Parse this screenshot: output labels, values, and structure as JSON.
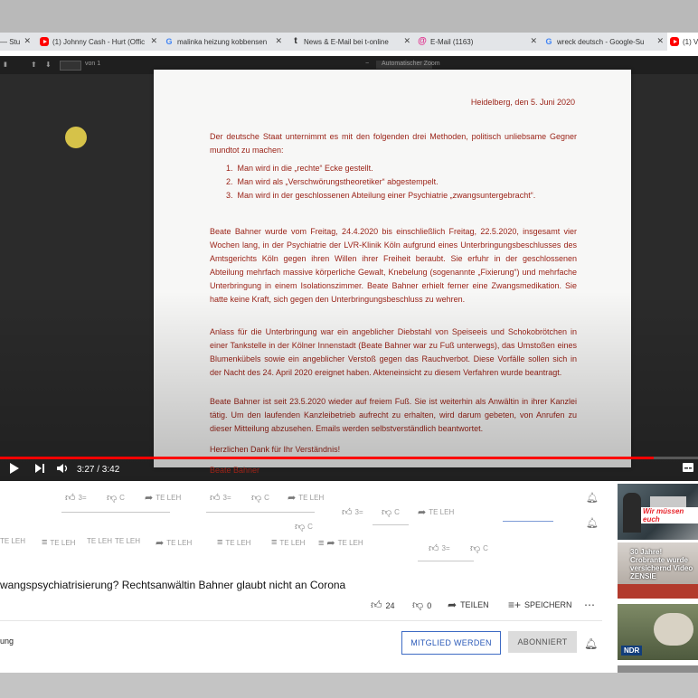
{
  "browser": {
    "tabs": [
      {
        "label": "— Stu",
        "icon": "",
        "active": false
      },
      {
        "label": "(1) Johnny Cash - Hurt (Offic",
        "icon": "youtube-favicon",
        "active": false
      },
      {
        "label": "malinka heizung kobbensen",
        "icon": "google-favicon",
        "active": false
      },
      {
        "label": "News & E-Mail bei t-online",
        "icon": "t-online-favicon",
        "active": false
      },
      {
        "label": "E-Mail (1163)",
        "icon": "email-favicon",
        "active": false
      },
      {
        "label": "wreck deutsch - Google-Su",
        "icon": "google-favicon",
        "active": false
      },
      {
        "label": "(1) V",
        "icon": "youtube-favicon",
        "active": true
      }
    ]
  },
  "pdf_viewer": {
    "page_label": "von 1",
    "zoom_label": "Automatischer Zoom"
  },
  "letter": {
    "place_date": "Heidelberg, den 5. Juni 2020",
    "intro": "Der deutsche Staat unternimmt es mit den folgenden drei Methoden, politisch unliebsame Gegner mundtot zu machen:",
    "list": [
      "Man wird in die „rechte“ Ecke gestellt.",
      "Man wird als „Verschwörungstheoretiker“ abgestempelt.",
      "Man wird in der geschlossenen Abteilung einer Psychiatrie „zwangsuntergebracht“."
    ],
    "para1": "Beate Bahner wurde vom Freitag, 24.4.2020 bis einschließlich Freitag, 22.5.2020, insgesamt vier Wochen lang, in der Psychiatrie der LVR-Klinik Köln aufgrund eines Unterbringungsbeschlusses des Amtsgerichts Köln gegen ihren Willen ihrer Freiheit beraubt. Sie erfuhr in der geschlossenen Abteilung mehrfach massive körperliche Gewalt, Knebelung (sogenannte „Fixierung“) und mehrfache Unterbringung in einem Isolationszimmer. Beate Bahner erhielt ferner eine Zwangsmedikation. Sie hatte keine Kraft, sich gegen den Unterbringungsbeschluss zu wehren.",
    "para2": "Anlass für die Unterbringung war ein angeblicher Diebstahl von Speiseeis und Schokobrötchen in einer Tankstelle in der Kölner Innenstadt (Beate Bahner war zu Fuß unterwegs), das Umstoßen eines Blumenkübels sowie ein angeblicher Verstoß gegen das Rauchverbot. Diese Vorfälle sollen sich in der Nacht des 24. April 2020 ereignet haben. Akteneinsicht zu diesem Verfahren wurde beantragt.",
    "para3": "Beate Bahner ist seit 23.5.2020 wieder auf freiem Fuß. Sie ist weiterhin als Anwältin in ihrer Kanzlei tätig. Um den laufenden Kanzleibetrieb aufrecht zu erhalten, wird darum gebeten, von Anrufen zu dieser Mitteilung abzusehen. Emails werden selbstverständlich beantwortet.",
    "closing": "Herzlichen Dank für Ihr Verständnis!",
    "signature": "Beate Bahner"
  },
  "player": {
    "time": "3:27 / 3:42",
    "progress": 0.936
  },
  "ghost": {
    "likes": "3=",
    "dislikes": "C",
    "share": "TE LEH",
    "save": "TE LEH"
  },
  "video": {
    "title": "wangspsychiatrisierung? Rechtsanwältin Bahner glaubt nicht an Corona",
    "likes": "24",
    "dislikes": "0",
    "share_label": "TEILEN",
    "save_label": "SPEICHERN",
    "channel_fragment": "ung",
    "member_button": "MITGLIED WERDEN",
    "subscribe_button": "ABONNIERT"
  },
  "recommendations": [
    {
      "caption": "Wir müssen euch"
    },
    {
      "caption": "30 Jahre! Crobrante wurde versichernd Video ZENSIE"
    },
    {
      "caption": "NDR"
    }
  ],
  "colors": {
    "letter_text": "#9b2318",
    "progress": "#ff0000",
    "member_border": "#3e6bc4"
  }
}
